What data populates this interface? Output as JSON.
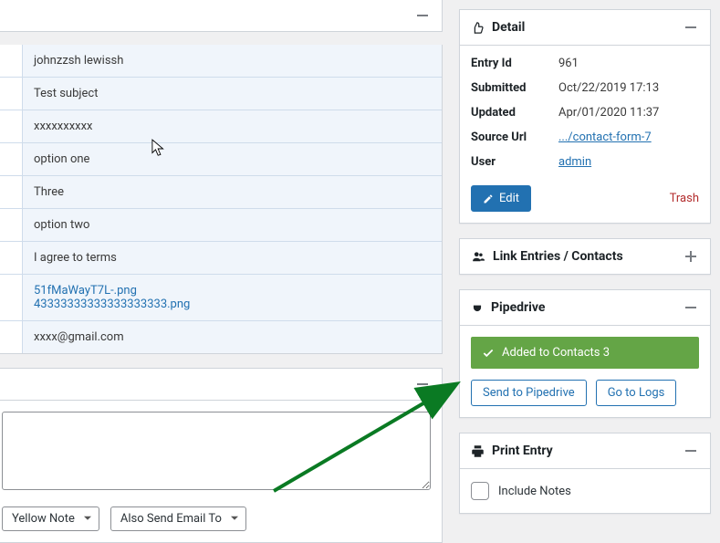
{
  "left": {
    "rows": [
      {
        "text": "johnzzsh lewissh"
      },
      {
        "text": "Test subject"
      },
      {
        "text": "xxxxxxxxxx"
      },
      {
        "text": "option one"
      },
      {
        "text": "Three"
      },
      {
        "text": "option two"
      },
      {
        "text": "I agree to terms"
      },
      {
        "links": [
          "51fMaWayT7L-.png",
          "43333333333333333333.png"
        ]
      },
      {
        "text": "xxxx@gmail.com"
      }
    ],
    "textarea_value": "",
    "selects": {
      "color": "Yellow Note",
      "email_action": "Also Send Email To"
    }
  },
  "detail": {
    "title": "Detail",
    "fields": {
      "entry_id": {
        "k": "Entry Id",
        "v": "961"
      },
      "submitted": {
        "k": "Submitted",
        "v": "Oct/22/2019 17:13"
      },
      "updated": {
        "k": "Updated",
        "v": "Apr/01/2020 11:37"
      },
      "source_url": {
        "k": "Source Url",
        "v": ".../contact-form-7"
      },
      "user": {
        "k": "User",
        "v": "admin"
      }
    },
    "edit_label": "Edit",
    "trash_label": "Trash"
  },
  "link_entries": {
    "title": "Link Entries / Contacts"
  },
  "pipedrive": {
    "title": "Pipedrive",
    "success": "Added to Contacts 3",
    "send_label": "Send to Pipedrive",
    "logs_label": "Go to Logs"
  },
  "print": {
    "title": "Print Entry",
    "include_notes": "Include Notes"
  }
}
